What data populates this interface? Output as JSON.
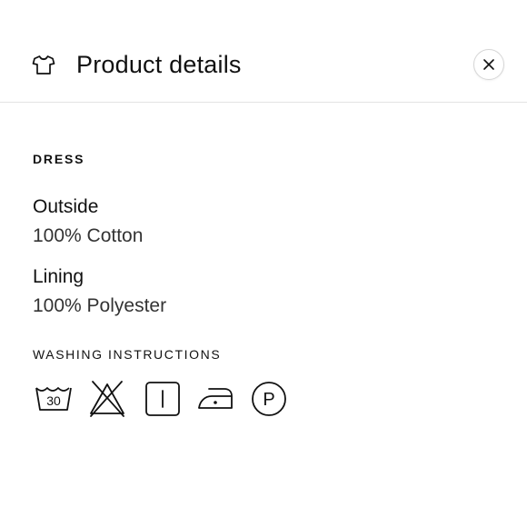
{
  "header": {
    "title": "Product details",
    "icon": "tshirt-icon",
    "close_icon": "close-icon"
  },
  "section": {
    "label": "DRESS"
  },
  "materials": [
    {
      "heading": "Outside",
      "value": "100% Cotton"
    },
    {
      "heading": "Lining",
      "value": "100% Polyester"
    }
  ],
  "washing": {
    "label": "WASHING INSTRUCTIONS",
    "icons": [
      {
        "name": "wash-30-icon",
        "text": "30"
      },
      {
        "name": "no-bleach-icon"
      },
      {
        "name": "tumble-dry-icon"
      },
      {
        "name": "iron-low-icon"
      },
      {
        "name": "dry-clean-p-icon",
        "text": "P"
      }
    ]
  }
}
